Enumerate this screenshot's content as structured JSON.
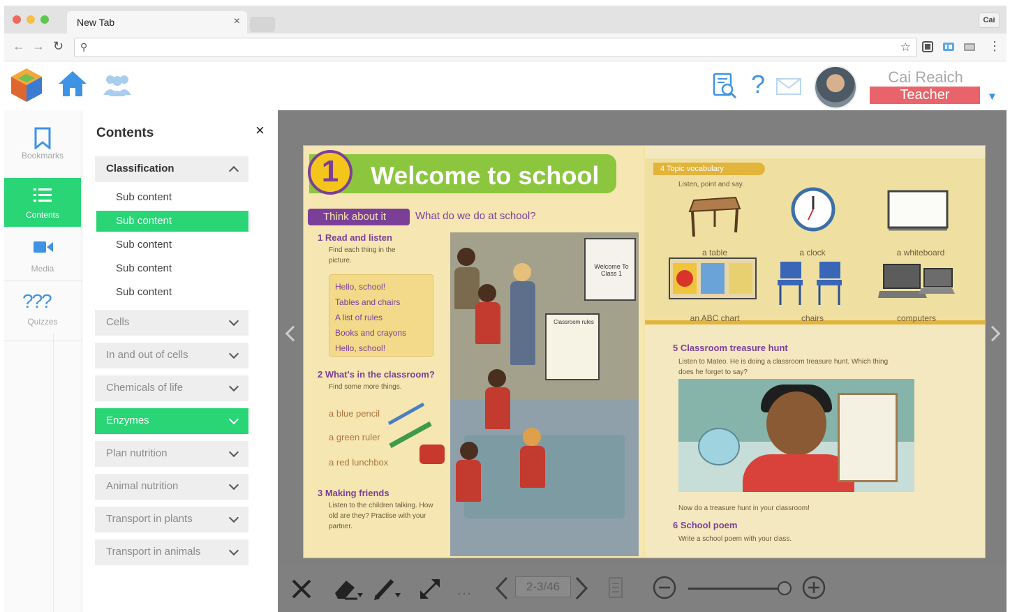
{
  "browser": {
    "tab_title": "New Tab",
    "tab_close": "×",
    "profile_chip": "Cai",
    "address_value": "",
    "address_placeholder": ""
  },
  "header": {
    "icons": [
      "app-logo-icon",
      "home-icon",
      "group-icon",
      "search-document-icon",
      "help-icon",
      "mail-icon"
    ],
    "help_glyph": "?",
    "user_name": "Cai Reaich",
    "user_role": "Teacher",
    "role_caret": "▼",
    "colors": {
      "accent": "#3f93e4",
      "role_badge": "#e9646a"
    }
  },
  "rail": {
    "items": [
      {
        "label": "Bookmarks",
        "icon": "bookmark-icon",
        "active": false
      },
      {
        "label": "Contents",
        "icon": "list-icon",
        "active": true
      },
      {
        "label": "Media",
        "icon": "video-camera-icon",
        "active": false
      },
      {
        "label": "Quizzes",
        "icon": "quiz-icon",
        "active": false
      }
    ],
    "quiz_glyph": "?",
    "active_color": "#2ad576"
  },
  "contents": {
    "title": "Contents",
    "close": "×",
    "sections": [
      {
        "label": "Classification",
        "open": true,
        "active": false,
        "subs": [
          {
            "label": "Sub content",
            "active": false
          },
          {
            "label": "Sub content",
            "active": true
          },
          {
            "label": "Sub content",
            "active": false
          },
          {
            "label": "Sub content",
            "active": false
          },
          {
            "label": "Sub content",
            "active": false
          }
        ]
      },
      {
        "label": "Cells",
        "open": false,
        "active": false
      },
      {
        "label": "In and out of cells",
        "open": false,
        "active": false
      },
      {
        "label": "Chemicals of life",
        "open": false,
        "active": false
      },
      {
        "label": "Enzymes",
        "open": false,
        "active": true
      },
      {
        "label": "Plan nutrition",
        "open": false,
        "active": false
      },
      {
        "label": "Animal nutrition",
        "open": false,
        "active": false
      },
      {
        "label": "Transport in plants",
        "open": false,
        "active": false
      },
      {
        "label": "Transport in animals",
        "open": false,
        "active": false
      }
    ]
  },
  "book": {
    "unit_number": "1",
    "unit_title": "Welcome to school",
    "think_label": "Think about it",
    "think_question": "What do we do at school?",
    "read_title": "1 Read and listen",
    "read_sub": "Find each thing in the picture.",
    "song_lines": [
      "Hello, school!",
      "Tables and chairs",
      "A list of rules",
      "Books and crayons",
      "Hello, school!"
    ],
    "classroom_title": "2 What's in the classroom?",
    "classroom_sub": "Find some more things.",
    "words": [
      "a blue pencil",
      "a green ruler",
      "a red lunchbox"
    ],
    "friends_title": "3 Making friends",
    "friends_sub": "Listen to the children talking. How old are they? Practise with your partner.",
    "board_text": "Welcome To Class 1",
    "poster_text": "Classroom rules",
    "vocab_header": "4 Topic vocabulary",
    "vocab_sub": "Listen, point and say.",
    "vocab_items": [
      "a table",
      "a clock",
      "a whiteboard",
      "an ABC chart",
      "chairs",
      "computers"
    ],
    "hunt_title": "5 Classroom treasure hunt",
    "hunt_sub": "Listen to Mateo. He is doing a classroom treasure hunt. Which thing does he forget to say?",
    "hunt_footer": "Now do a treasure hunt in your classroom!",
    "poem_title": "6 School poem",
    "poem_sub": "Write a school poem with your class."
  },
  "viewer": {
    "page_indicator": "2-3/46",
    "toolbar_icons": [
      "close-icon",
      "eraser-icon",
      "pen-icon",
      "fullscreen-icon",
      "more-icon",
      "prev-page-icon",
      "next-page-icon",
      "page-icon",
      "zoom-out-icon",
      "zoom-in-icon"
    ],
    "zoom_level": 0.95
  }
}
